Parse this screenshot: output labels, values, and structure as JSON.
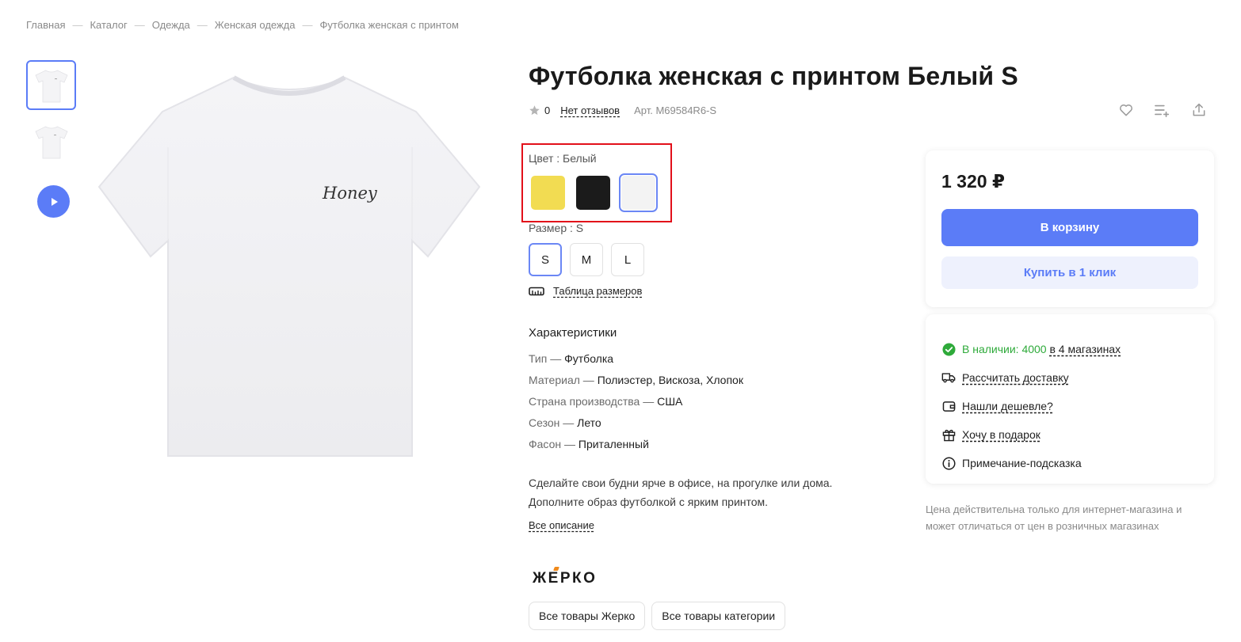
{
  "breadcrumb": [
    "Главная",
    "Каталог",
    "Одежда",
    "Женская одежда",
    "Футболка женская с принтом"
  ],
  "product": {
    "title": "Футболка женская с принтом Белый S",
    "rating": "0",
    "reviews_link": "Нет отзывов",
    "sku": "Арт. M69584R6-S",
    "print_text": "Honey"
  },
  "actions": {
    "favorite_icon": "heart-icon",
    "compare_icon": "add-list-icon",
    "share_icon": "share-icon"
  },
  "color": {
    "label": "Цвет : Белый",
    "options": [
      {
        "name": "yellow",
        "hex": "#f2dc52"
      },
      {
        "name": "black",
        "hex": "#1b1b1b"
      },
      {
        "name": "white",
        "hex": "#f3f3f3"
      }
    ],
    "selected": "white"
  },
  "size": {
    "label": "Размер : S",
    "options": [
      "S",
      "M",
      "L"
    ],
    "selected": "S",
    "table_link": "Таблица размеров"
  },
  "specs": {
    "title": "Характеристики",
    "rows": [
      {
        "key": "Тип — ",
        "value": "Футболка"
      },
      {
        "key": "Материал — ",
        "value": "Полиэстер, Вискоза, Хлопок"
      },
      {
        "key": "Страна производства — ",
        "value": "США"
      },
      {
        "key": "Сезон — ",
        "value": "Лето"
      },
      {
        "key": "Фасон — ",
        "value": "Приталенный"
      }
    ]
  },
  "description": {
    "line1": "Сделайте свои будни ярче в офисе, на прогулке или дома.",
    "line2": "Дополните образ футболкой с ярким принтом.",
    "all_link": "Все описание"
  },
  "brand": {
    "logo": "ЖЕРКО",
    "all_brand_button": "Все товары Жерко",
    "all_category_button": "Все товары категории"
  },
  "buy": {
    "price": "1 320 ₽",
    "cart_button": "В корзину",
    "one_click_button": "Купить в 1 клик"
  },
  "info": {
    "stock_prefix": "В наличии: 4000",
    "stock_link": "в 4 магазинах",
    "delivery": "Рассчитать доставку",
    "cheaper": "Нашли дешевле?",
    "gift": "Хочу в подарок",
    "hint": "Примечание-подсказка"
  },
  "price_note": {
    "line1": "Цена действительна только для интернет-магазина и",
    "line2": "может отличаться от цен в розничных магазинах"
  },
  "colors": {
    "accent": "#5b7cf7",
    "highlight_border": "#e2101a",
    "stock_green": "#2eaa3a"
  }
}
